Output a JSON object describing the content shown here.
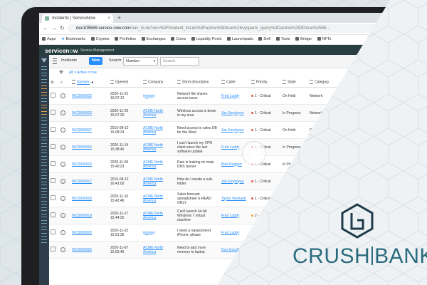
{
  "browser": {
    "tab_title": "Incidents | ServiceNow",
    "tab_close": "×",
    "new_tab": "+",
    "url_host": "dev105589.service-now.com",
    "url_path": "/nav_to.do?uri=%2Fincident_list.do%3Factive%3Dtrue%26sysparm_query%3Dactive%253Dtrue%255E...",
    "bookmarks": [
      "Apps",
      "Bookmarks",
      "Cryptos",
      "Portfolios",
      "Exchanges",
      "Coins",
      "Liquidity Pools",
      "Launchpads",
      "Defi",
      "Tools",
      "Bridge",
      "NFTs"
    ]
  },
  "app": {
    "logo_a": "servicen",
    "logo_o": "o",
    "logo_b": "w",
    "subtitle": "Service Management"
  },
  "list": {
    "title": "Incidents",
    "new_label": "New",
    "search_label": "Search",
    "search_field": "Number",
    "search_placeholder": "Search",
    "breadcrumb": "All > Active = true",
    "columns": [
      "Number",
      "Opened",
      "Company",
      "Short description",
      "Caller",
      "Priority",
      "State",
      "Category",
      "Ass"
    ],
    "rows": [
      {
        "number": "INC0000002",
        "opened": "2020-11-22 15:07:12",
        "company": "(empty)",
        "desc": "Network file shares access issue",
        "caller": "Fred Luddy",
        "priority": "1 - Critical",
        "pcolor": "#e05b4b",
        "state": "On Hold",
        "category": "Network",
        "ass": "Bea"
      },
      {
        "number": "INC0000003",
        "opened": "2020-11-29 15:07:30",
        "company": "ACME North America",
        "desc": "Wireless access is down in my area",
        "caller": "Joe Employee",
        "priority": "1 - Critical",
        "pcolor": "#e05b4b",
        "state": "In Progress",
        "category": "Network",
        "ass": ""
      },
      {
        "number": "INC0000007",
        "opened": "2015-08-12 16:08:24",
        "company": "ACME North America",
        "desc": "Need access to sales DB for the West",
        "caller": "Joe Employee",
        "priority": "1 - Critical",
        "pcolor": "#e05b4b",
        "state": "On Hold",
        "category": "Database",
        "ass": ""
      },
      {
        "number": "INC0000015",
        "opened": "2020-11-14 15:38:46",
        "company": "ACME North America",
        "desc": "I can't launch my VPN client since the last software update",
        "caller": "Fred Luddy",
        "priority": "1 - Critical",
        "pcolor": "#e05b4b",
        "state": "In Progress",
        "category": "Softw",
        "ass": ""
      },
      {
        "number": "INC0000016",
        "opened": "2020-11-09 15:40:23",
        "company": "ACME North America",
        "desc": "Rain is leaking on main DNS Server",
        "caller": "Bow Ruggeri",
        "priority": "1 - Critical",
        "pcolor": "#e05b4b",
        "state": "In Progress",
        "category": "",
        "ass": ""
      },
      {
        "number": "INC0000017",
        "opened": "2015-08-12 16:41:00",
        "company": "ACME North America",
        "desc": "How do I create a sub-folder",
        "caller": "Joe Employee",
        "priority": "1 - Critical",
        "pcolor": "#e05b4b",
        "state": "On Hold",
        "category": "",
        "ass": ""
      },
      {
        "number": "INC0000018",
        "opened": "2020-11-15 15:42:46",
        "company": "ACME North America",
        "desc": "Sales forecast spreadsheet is READ ONLY",
        "caller": "Taylor Vreeland",
        "priority": "1 - Critical",
        "pcolor": "#e05b4b",
        "state": "In Pr",
        "category": "",
        "ass": ""
      },
      {
        "number": "INC0000019",
        "opened": "2020-11-17 15:44:20",
        "company": "ACME North America",
        "desc": "Can't launch 64-bit Windows 7 virtual machine",
        "caller": "Fred Luddy",
        "priority": "2 - High",
        "pcolor": "#f0a23b",
        "state": "",
        "category": "",
        "ass": ""
      },
      {
        "number": "INC0000020",
        "opened": "2020-11-22 15:51:35",
        "company": "(empty)",
        "desc": "I need a replacement iPhone, please",
        "caller": "Fred Luddy",
        "priority": "5 - Plannin",
        "pcolor": "#8bbf5a",
        "state": "",
        "category": "",
        "ass": ""
      },
      {
        "number": "INC0000025",
        "opened": "2020-11-07 15:53:46",
        "company": "ACME North America",
        "desc": "Need to add more memory to laptop",
        "caller": "Don Goodliffe",
        "priority": "1 - Criti",
        "pcolor": "#e05b4b",
        "state": "",
        "category": "",
        "ass": ""
      }
    ]
  },
  "brand": {
    "left": "CRUSH",
    "right": "BANK",
    "color": "#2b6b7e"
  }
}
